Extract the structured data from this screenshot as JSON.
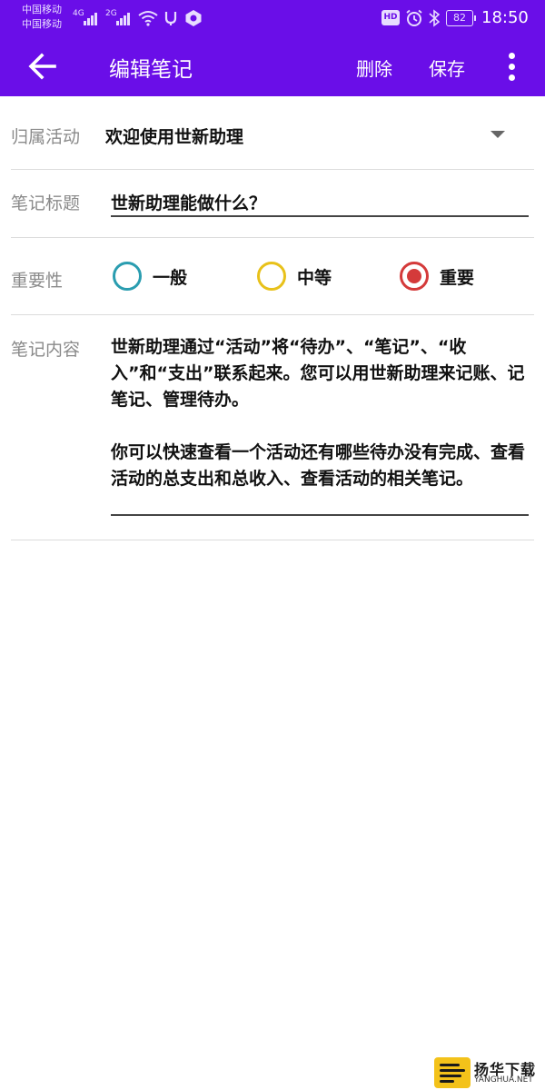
{
  "status_bar": {
    "carrier_1": "中国移动",
    "carrier_2": "中国移动",
    "network_1": "4G",
    "network_2": "2G",
    "hd_badge": "HD",
    "battery": "82",
    "time": "18:50",
    "icons": [
      "signal-icon",
      "wifi-icon",
      "usb-icon",
      "notification-icon",
      "alarm-icon",
      "bluetooth-icon"
    ]
  },
  "app_bar": {
    "title": "编辑笔记",
    "delete_label": "删除",
    "save_label": "保存",
    "icons": [
      "back-arrow-icon",
      "more-vert-icon"
    ]
  },
  "form": {
    "activity": {
      "label": "归属活动",
      "value": "欢迎使用世新助理"
    },
    "title": {
      "label": "笔记标题",
      "value": "世新助理能做什么？"
    },
    "importance": {
      "label": "重要性",
      "options": [
        {
          "label": "一般",
          "color": "#2a9db0",
          "selected": false
        },
        {
          "label": "中等",
          "color": "#e8c11a",
          "selected": false
        },
        {
          "label": "重要",
          "color": "#d43a3a",
          "selected": true
        }
      ]
    },
    "content": {
      "label": "笔记内容",
      "paragraph_1": "世新助理通过“活动”将“待办”、“笔记”、“收入”和“支出”联系起来。您可以用世新助理来记账、记笔记、管理待办。",
      "paragraph_2": "你可以快速查看一个活动还有哪些待办没有完成、查看活动的总支出和总收入、查看活动的相关笔记。"
    }
  },
  "watermark": {
    "name_cn": "扬华下载",
    "name_en": "YANGHUA.NET"
  },
  "colors": {
    "primary": "#6a0ee8",
    "label_gray": "#8a8a8a"
  }
}
